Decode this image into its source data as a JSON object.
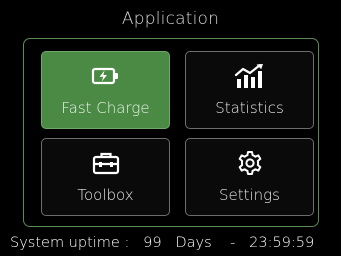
{
  "header": {
    "title": "Application"
  },
  "menu": {
    "tiles": [
      {
        "label": "Fast Charge",
        "icon": "battery-charging-icon",
        "selected": true
      },
      {
        "label": "Statistics",
        "icon": "bar-chart-trend-icon",
        "selected": false
      },
      {
        "label": "Toolbox",
        "icon": "toolbox-icon",
        "selected": false
      },
      {
        "label": "Settings",
        "icon": "gear-icon",
        "selected": false
      }
    ]
  },
  "status_bar": {
    "label": "System uptime :",
    "days_value": "99",
    "days_unit": "Days",
    "separator": "-",
    "time": "23:59:59"
  },
  "colors": {
    "background": "#000000",
    "panel_border": "#5b8a57",
    "selected_tile": "#4a8a45",
    "tile_border": "#6d6d6d",
    "text": "#ffffff"
  }
}
